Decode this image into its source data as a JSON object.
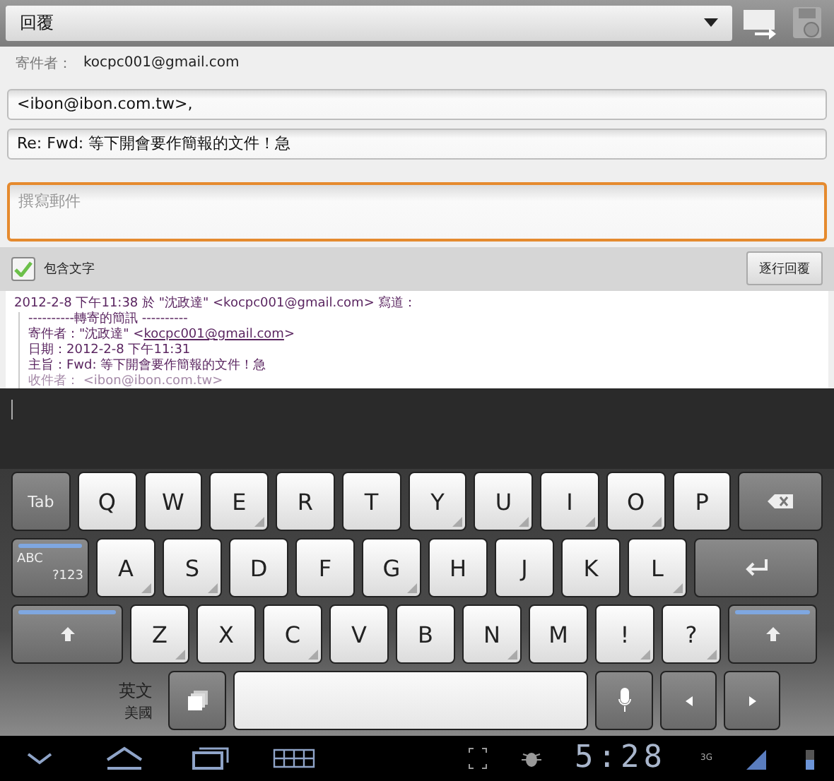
{
  "action_bar": {
    "mode": "回覆"
  },
  "from": {
    "label": "寄件者：",
    "value": "kocpc001@gmail.com"
  },
  "to_field": {
    "value": "<ibon@ibon.com.tw>,"
  },
  "subject_field": {
    "value": "Re: Fwd: 等下開會要作簡報的文件！急"
  },
  "body_field": {
    "placeholder": "撰寫郵件",
    "focused": true
  },
  "quote_bar": {
    "include_label": "包含文字",
    "checked": true,
    "button": "逐行回覆"
  },
  "quoted": {
    "header": "2012-2-8 下午11:38 於 \"沈政達\" <kocpc001@gmail.com> 寫道：",
    "lines": [
      {
        "text": "----------轉寄的簡訊 ----------"
      },
      {
        "text": "寄件者：\"沈政達\" <",
        "link": "kocpc001@gmail.com",
        "after": ">"
      },
      {
        "text": "日期：2012-2-8 下午11:31"
      },
      {
        "text": "主旨：Fwd: 等下開會要作簡報的文件！急"
      },
      {
        "text": "收件者： <ibon@ibon.com.tw>",
        "faded": true
      }
    ]
  },
  "keyboard": {
    "rows": [
      [
        {
          "kind": "tab",
          "label": "Tab"
        },
        {
          "label": "Q",
          "hint": false
        },
        {
          "label": "W",
          "hint": false
        },
        {
          "label": "E",
          "hint": true
        },
        {
          "label": "R",
          "hint": false
        },
        {
          "label": "T",
          "hint": false
        },
        {
          "label": "Y",
          "hint": true
        },
        {
          "label": "U",
          "hint": true
        },
        {
          "label": "I",
          "hint": true
        },
        {
          "label": "O",
          "hint": true
        },
        {
          "label": "P",
          "hint": false
        },
        {
          "kind": "backspace"
        }
      ],
      [
        {
          "kind": "mode",
          "label": "ABC",
          "sublabel": "?123"
        },
        {
          "label": "A",
          "hint": true
        },
        {
          "label": "S",
          "hint": true
        },
        {
          "label": "D",
          "hint": false
        },
        {
          "label": "F",
          "hint": false
        },
        {
          "label": "G",
          "hint": true
        },
        {
          "label": "H",
          "hint": false
        },
        {
          "label": "J",
          "hint": false
        },
        {
          "label": "K",
          "hint": false
        },
        {
          "label": "L",
          "hint": true
        },
        {
          "kind": "enter"
        }
      ],
      [
        {
          "kind": "shift"
        },
        {
          "label": "Z",
          "hint": true
        },
        {
          "label": "X",
          "hint": false
        },
        {
          "label": "C",
          "hint": true
        },
        {
          "label": "V",
          "hint": false
        },
        {
          "label": "B",
          "hint": false
        },
        {
          "label": "N",
          "hint": true
        },
        {
          "label": "M",
          "hint": false
        },
        {
          "label": "!",
          "hint": true
        },
        {
          "label": "?",
          "hint": true
        },
        {
          "kind": "shift"
        }
      ]
    ],
    "language": "英文",
    "region": "美國"
  },
  "status_bar": {
    "time": "5:28",
    "network": "3G"
  }
}
